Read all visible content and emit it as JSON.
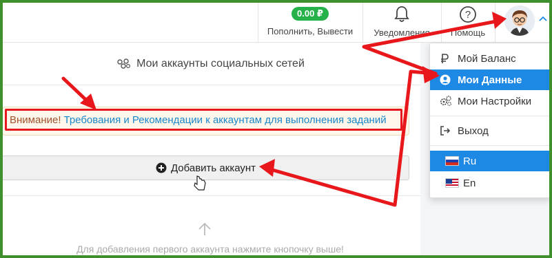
{
  "topbar": {
    "balance_amount": "0.00 ₽",
    "deposit_withdraw_label": "Пополнить, Вывести",
    "notifications_label": "Уведомления",
    "help_label": "Помощь"
  },
  "main": {
    "section_title": "Мои аккаунты социальных сетей",
    "notice_warning": "Внимание!",
    "notice_link": "Требования и Рекомендации к аккаунтам для выполнения заданий",
    "add_account_label": "Добавить аккаунт",
    "empty_hint": "Для добавления первого аккаунта нажмите кнопочку выше!"
  },
  "dropdown": {
    "items": [
      {
        "label": "Мой Баланс",
        "icon": "ruble-icon"
      },
      {
        "label": "Мои Данные",
        "icon": "user-circle-icon",
        "active": true
      },
      {
        "label": "Мои Настройки",
        "icon": "gears-icon"
      },
      {
        "label": "Выход",
        "icon": "sign-out-icon"
      }
    ],
    "languages": [
      {
        "label": "Ru",
        "active": true
      },
      {
        "label": "En"
      }
    ]
  },
  "colors": {
    "accent": "#1e88e5",
    "balance_green": "#26b14a",
    "annotation_red": "#e8171b",
    "frame_green": "#3f8f2c",
    "link": "#1a86c8"
  }
}
